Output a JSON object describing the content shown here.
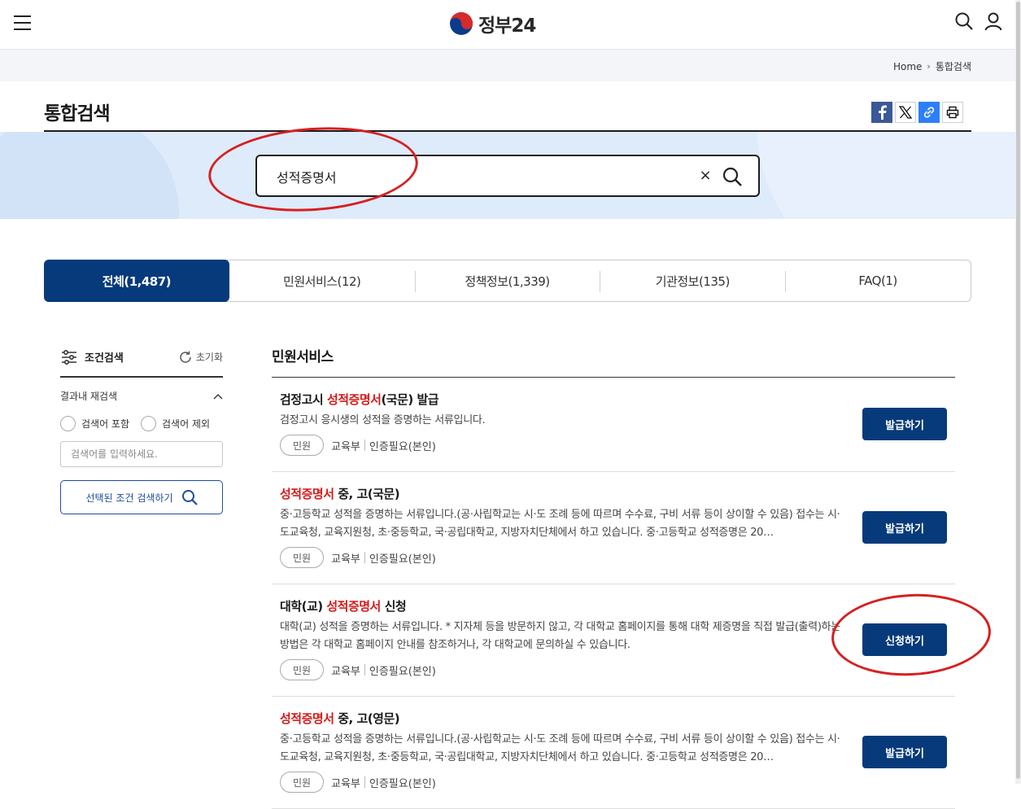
{
  "header": {
    "logo_text": "정부24",
    "menu_icon": "hamburger-icon",
    "search_icon": "search-icon",
    "user_icon": "user-icon"
  },
  "breadcrumb": {
    "home": "Home",
    "current": "통합검색"
  },
  "page": {
    "title": "통합검색"
  },
  "share": [
    "facebook-icon",
    "x-icon",
    "link-icon",
    "print-icon"
  ],
  "search": {
    "value": "성적증명서",
    "placeholder": ""
  },
  "tabs": [
    {
      "label": "전체(1,487)",
      "active": true
    },
    {
      "label": "민원서비스(12)"
    },
    {
      "label": "정책정보(1,339)"
    },
    {
      "label": "기관정보(135)"
    },
    {
      "label": "FAQ(1)"
    }
  ],
  "filter": {
    "title": "조건검색",
    "reset": "초기화",
    "refine_title": "결과내 재검색",
    "include": "검색어 포함",
    "exclude": "검색어 제외",
    "input_placeholder": "검색어를 입력하세요.",
    "apply": "선택된 조건 검색하기"
  },
  "section": {
    "title": "민원서비스"
  },
  "results": [
    {
      "pre": "검정고시 ",
      "hl": "성적증명서",
      "post": "(국문) 발급",
      "desc": "검정고시 응시생의 성적을 증명하는 서류입니다.",
      "chip": "민원",
      "org": "교육부",
      "auth": "인증필요(본인)",
      "action": "발급하기"
    },
    {
      "pre": "",
      "hl": "성적증명서",
      "post": " 중, 고(국문)",
      "desc": "중·고등학교 성적을 증명하는 서류입니다.(공·사립학교는 시·도 조례 등에 따르며 수수료, 구비 서류 등이 상이할 수 있음) 접수는 시·도교육청, 교육지원청, 초·중등학교, 국·공립대학교, 지방자치단체에서 하고 있습니다. 중·고등학교 성적증명은 20…",
      "chip": "민원",
      "org": "교육부",
      "auth": "인증필요(본인)",
      "action": "발급하기"
    },
    {
      "pre": "대학(교) ",
      "hl": "성적증명서",
      "post": " 신청",
      "desc": "대학(교) 성적을 증명하는 서류입니다. * 지자체 등을 방문하지 않고, 각 대학교 홈페이지를 통해 대학 제증명을 직접 발급(출력)하는 방법은 각 대학교 홈페이지 안내를 참조하거나, 각 대학교에 문의하실 수 있습니다.",
      "chip": "민원",
      "org": "교육부",
      "auth": "인증필요(본인)",
      "action": "신청하기"
    },
    {
      "pre": "",
      "hl": "성적증명서",
      "post": " 중, 고(영문)",
      "desc": "중·고등학교 성적을 증명하는 서류입니다.(공·사립학교는 시·도 조례 등에 따르며 수수료, 구비 서류 등이 상이할 수 있음) 접수는 시·도교육청, 교육지원청, 초·중등학교, 국·공립대학교, 지방자치단체에서 하고 있습니다. 중·고등학교 성적증명은 20…",
      "chip": "민원",
      "org": "교육부",
      "auth": "인증필요(본인)",
      "action": "발급하기"
    }
  ],
  "colors": {
    "primary": "#063a7a",
    "highlight": "#d51a1a",
    "band": "#deebfb",
    "annotation": "#d62020"
  }
}
